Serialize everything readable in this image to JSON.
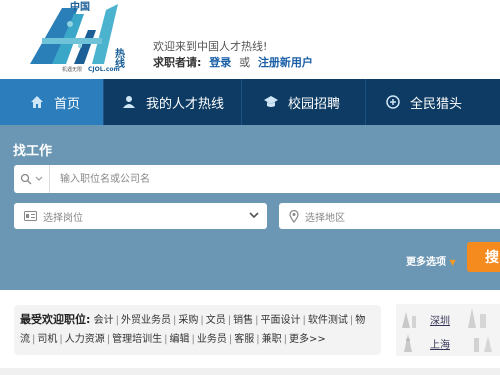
{
  "logo": {
    "chars_top": "中国",
    "chars_right": "热线",
    "slogan": "机遇无限",
    "url": "CJOL.com"
  },
  "header": {
    "welcome": "欢迎来到中国人才热线!",
    "seeker_label": "求职者请:",
    "login": "登录",
    "or": "或",
    "register": "注册新用户"
  },
  "nav": {
    "items": [
      {
        "label": "首页",
        "icon": "home-icon"
      },
      {
        "label": "我的人才热线",
        "icon": "user-icon"
      },
      {
        "label": "校园招聘",
        "icon": "graduation-cap-icon"
      },
      {
        "label": "全民猎头",
        "icon": "plus-circle-icon"
      }
    ]
  },
  "search": {
    "title": "找工作",
    "keyword_placeholder": "输入职位名或公司名",
    "job_placeholder": "选择岗位",
    "area_placeholder": "选择地区",
    "more_options": "更多选项",
    "search_button": "搜"
  },
  "popular": {
    "label": "最受欢迎职位:",
    "jobs": [
      "会计",
      "外贸业务员",
      "采购",
      "文员",
      "销售",
      "平面设计",
      "软件测试",
      "物流",
      "司机",
      "人力资源",
      "管理培训生",
      "编辑",
      "业务员",
      "客服",
      "兼职"
    ],
    "more": "更多>>"
  },
  "cities": {
    "items": [
      "深圳",
      "上海"
    ]
  },
  "colors": {
    "nav_bg": "#0d3b63",
    "nav_active": "#2b7dbc",
    "search_bg": "#6b97b4",
    "accent_orange": "#f58a1f",
    "link_blue": "#1a5fa8"
  }
}
